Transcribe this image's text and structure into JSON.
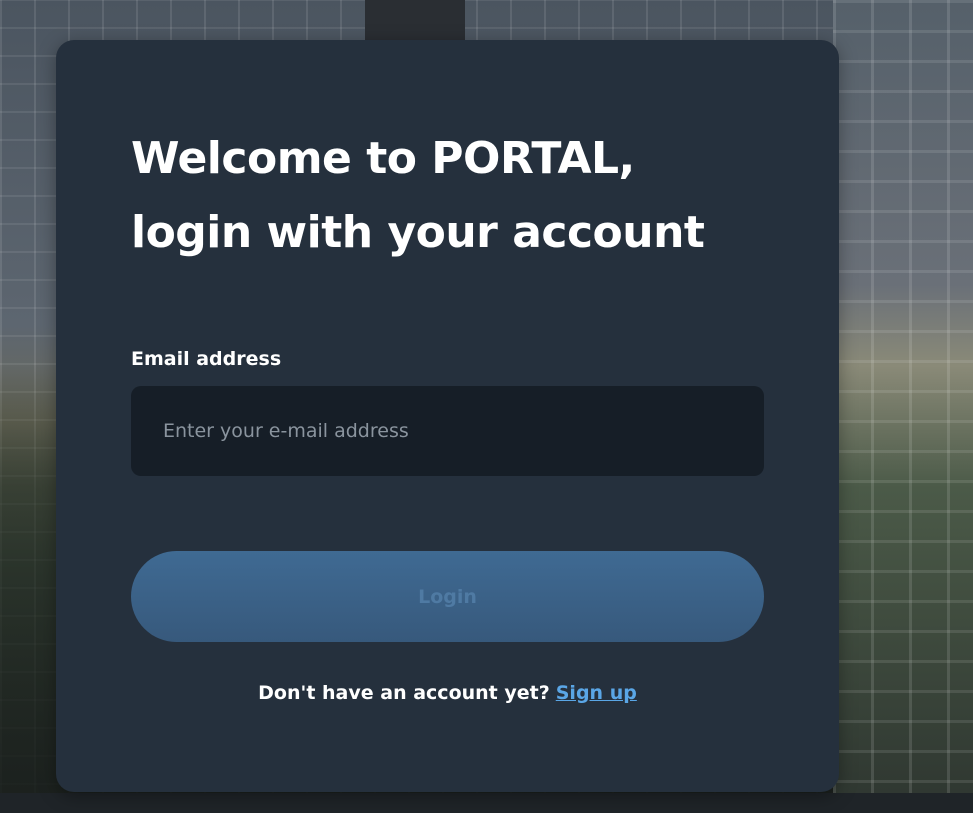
{
  "login": {
    "title_line1": "Welcome to PORTAL,",
    "title_line2": "login with your account",
    "email_label": "Email address",
    "email_placeholder": "Enter your e-mail address",
    "email_value": "",
    "login_button": "Login",
    "no_account_text": "Don't have an account yet?",
    "signup_link": "Sign up"
  },
  "colors": {
    "card_background": "#25303d",
    "input_background": "#161e27",
    "button_background": "#3f6a93",
    "link": "#5aa6e6"
  }
}
